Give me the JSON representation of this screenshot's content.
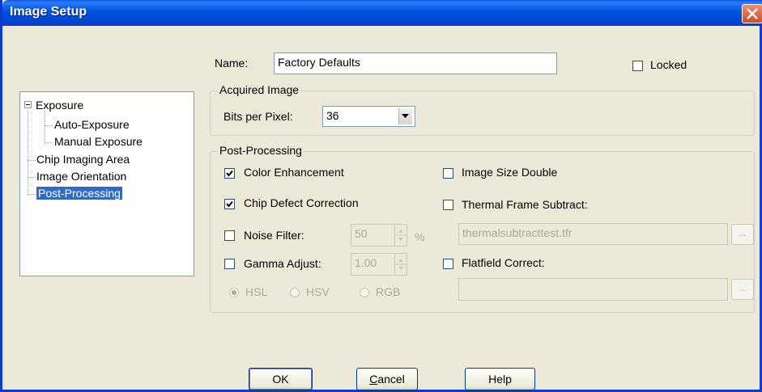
{
  "window": {
    "title": "Image Setup"
  },
  "name_field": {
    "label": "Name:",
    "value": "Factory Defaults"
  },
  "locked": {
    "label": "Locked",
    "checked": false
  },
  "tree": {
    "items": [
      {
        "label": "Exposure",
        "expanded": true
      },
      {
        "label": "Auto-Exposure"
      },
      {
        "label": "Manual Exposure"
      },
      {
        "label": "Chip Imaging Area"
      },
      {
        "label": "Image Orientation"
      },
      {
        "label": "Post-Processing",
        "selected": true
      }
    ]
  },
  "acquired_image": {
    "title": "Acquired Image",
    "bits_label": "Bits per Pixel:",
    "bits_value": "36"
  },
  "post_processing": {
    "title": "Post-Processing",
    "color_enhancement": {
      "label": "Color Enhancement",
      "checked": true
    },
    "chip_defect": {
      "label": "Chip Defect Correction",
      "checked": true
    },
    "noise_filter": {
      "label": "Noise Filter:",
      "checked": false,
      "value": "50",
      "unit": "%"
    },
    "gamma_adjust": {
      "label": "Gamma Adjust:",
      "checked": false,
      "value": "1.00"
    },
    "color_space": {
      "options": [
        "HSL",
        "HSV",
        "RGB"
      ],
      "selected": "HSL"
    },
    "image_size_double": {
      "label": "Image Size Double",
      "checked": false
    },
    "thermal_frame": {
      "label": "Thermal Frame Subtract:",
      "checked": false,
      "file": "thermalsubtracttest.tfr"
    },
    "flatfield": {
      "label": "Flatfield Correct:",
      "checked": false,
      "file": ""
    },
    "browse_label": "..."
  },
  "buttons": {
    "ok": "OK",
    "cancel_rest": "ancel",
    "cancel_mnemonic": "C",
    "help": "Help"
  },
  "colors": {
    "title_bar": "#0a58e8",
    "selection": "#316ac5",
    "dialog_bg": "#ece9d8"
  }
}
